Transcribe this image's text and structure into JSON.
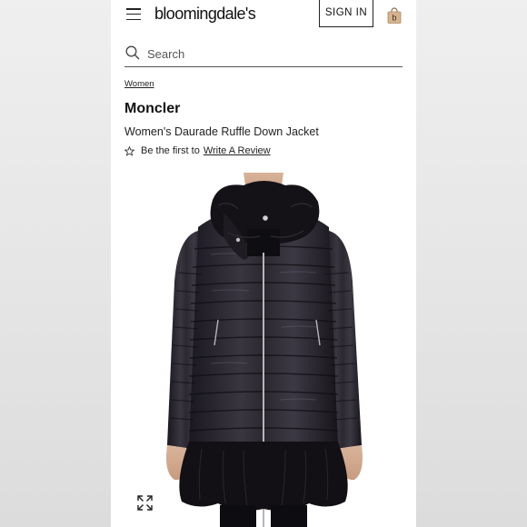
{
  "header": {
    "logo_text": "bloomingdale's",
    "sign_in_label": "SIGN IN",
    "bag_icon": "shopping-bag-icon",
    "bag_letter": "b",
    "menu_icon": "hamburger-menu-icon"
  },
  "search": {
    "placeholder": "Search",
    "icon": "search-icon"
  },
  "breadcrumb": {
    "label": "Women"
  },
  "product": {
    "brand": "Moncler",
    "name": "Women's Daurade Ruffle Down Jacket",
    "review_prefix": "Be the first to",
    "review_link": "Write A Review",
    "star_icon": "star-outline-icon",
    "image_alt": "black quilted down jacket with ruffle collar and ruffle hem",
    "expand_icon": "expand-icon"
  },
  "colors": {
    "accent_bag": "#c9a27a",
    "text": "#111111",
    "background": "#ffffff"
  }
}
